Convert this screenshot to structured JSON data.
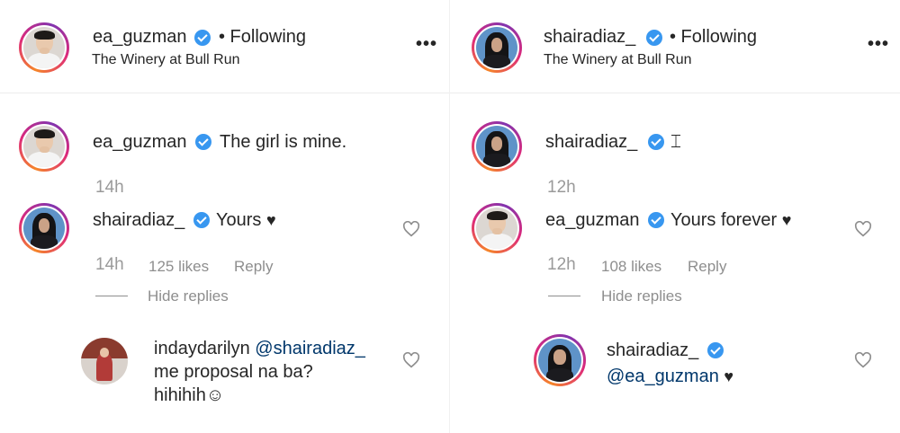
{
  "left": {
    "header": {
      "username": "ea_guzman",
      "follow": "• Following",
      "location": "The Winery at Bull Run",
      "more": "•••"
    },
    "caption": {
      "username": "ea_guzman",
      "text": "The girl is mine.",
      "time": "14h"
    },
    "comment": {
      "username": "shairadiaz_",
      "text": "Yours",
      "heart": "♥",
      "time": "14h",
      "likes": "125 likes",
      "reply": "Reply",
      "hide_replies": "Hide replies"
    },
    "reply_comment": {
      "username": "indaydarilyn",
      "mention": "@shairadiaz_",
      "line2": "me proposal na ba?",
      "line3": "hihihih☺"
    }
  },
  "right": {
    "header": {
      "username": "shairadiaz_",
      "follow": "• Following",
      "location": "The Winery at Bull Run",
      "more": "•••"
    },
    "caption": {
      "username": "shairadiaz_",
      "text": "⌶",
      "time": "12h"
    },
    "comment": {
      "username": "ea_guzman",
      "text": "Yours forever",
      "heart": "♥",
      "time": "12h",
      "likes": "108 likes",
      "reply": "Reply",
      "hide_replies": "Hide replies"
    },
    "reply_comment": {
      "username": "shairadiaz_",
      "mention": "@ea_guzman",
      "heart": "♥"
    }
  },
  "colors": {
    "verified": "#3897f0",
    "meta": "#8e8e8e",
    "text": "#262626"
  },
  "icons": [
    "verified-badge-icon",
    "more-options-icon",
    "heart-outline-icon",
    "black-heart-emoji"
  ]
}
